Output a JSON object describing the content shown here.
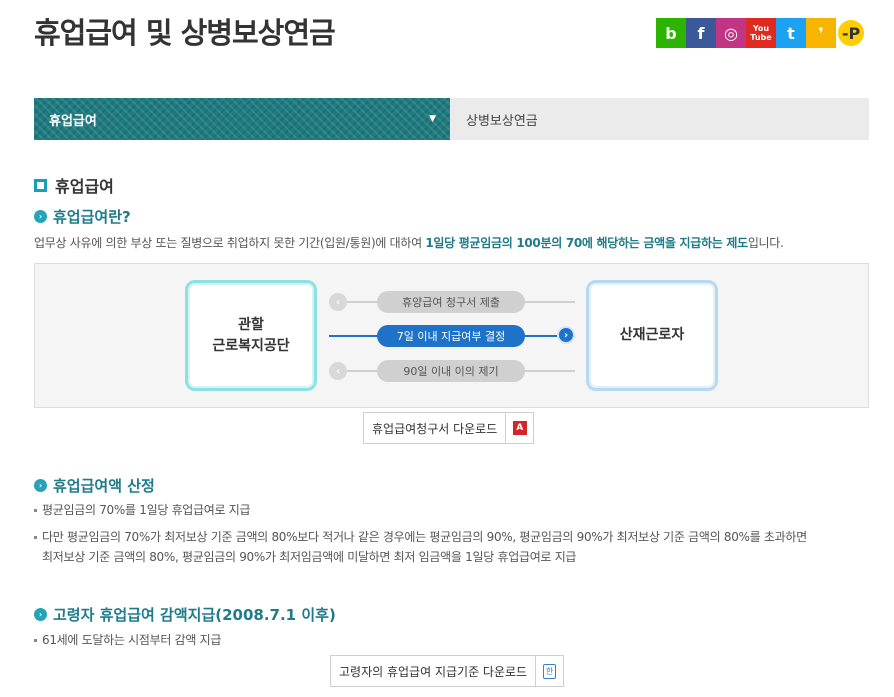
{
  "header": {
    "title": "휴업급여 및 상병보상연금",
    "social": [
      {
        "name": "blog-icon",
        "glyph": "b",
        "color": "#2db400"
      },
      {
        "name": "facebook-icon",
        "glyph": "f",
        "color": "#3b5998"
      },
      {
        "name": "instagram-icon",
        "glyph": "◎",
        "color": "#c13584"
      },
      {
        "name": "youtube-icon",
        "glyph": "You Tube",
        "color": "#e02a20"
      },
      {
        "name": "twitter-icon",
        "glyph": "t",
        "color": "#1da1f2"
      },
      {
        "name": "kakaostory-icon",
        "glyph": "❜",
        "color": "#f7b500"
      },
      {
        "name": "kakaopay-icon",
        "glyph": "-P",
        "color": "#ffcd00"
      }
    ]
  },
  "tabs": {
    "active": "휴업급여",
    "inactive": "상병보상연금"
  },
  "section": {
    "title": "휴업급여",
    "what_is": {
      "heading": "휴업급여란?",
      "desc_pre": "업무상 사유에 의한 부상 또는 질병으로 취업하지 못한 기간(입원/통원)에 대하여 ",
      "desc_hl": "1일당 평균임금의 100분의 70에 해당하는 금액을 지급하는 제도",
      "desc_post": "입니다."
    },
    "flow": {
      "left_node_line1": "관할",
      "left_node_line2": "근로복지공단",
      "right_node": "산재근로자",
      "step1": "휴양급여 청구서 제출",
      "step2": "7일 이내 지급여부 결정",
      "step3": "90일 이내 이의 제기"
    },
    "download1": "휴업급여청구서 다운로드",
    "calc": {
      "heading": "휴업급여액 산정",
      "item1": "평균임금의 70%를 1일당 휴업급여로 지급",
      "item2_line1": "다만 평균임금의 70%가 최저보상 기준 금액의 80%보다 적거나 같은 경우에는 평균임금의 90%, 평균임금의 90%가 최저보상 기준 금액의 80%를 초과하면",
      "item2_line2": "최저보상 기준 금액의 80%, 평균임금의 90%가 최저임금액에 미달하면 최저 임금액을 1일당 휴업급여로 지급"
    },
    "elderly": {
      "heading": "고령자 휴업급여 감액지급(2008.7.1 이후)",
      "item1": "61세에 도달하는 시점부터 감액 지급"
    },
    "download2": "고령자의 휴업급여 지급기준 다운로드",
    "pdf_icon_text": "A",
    "hwp_icon_text": "한"
  }
}
